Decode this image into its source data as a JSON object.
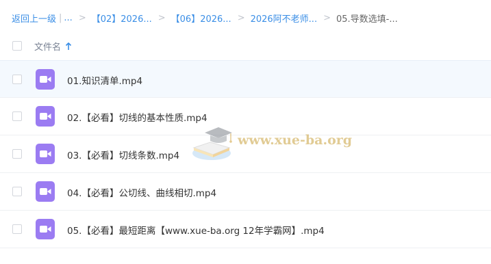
{
  "breadcrumb": {
    "back_label": "返回上一级",
    "separator": "|",
    "ellipsis": "...",
    "arrow": ">",
    "items": [
      {
        "label": "【02】2026..."
      },
      {
        "label": "【06】2026..."
      },
      {
        "label": "2026阿不老师..."
      }
    ],
    "current": "05.导数选填-..."
  },
  "table": {
    "column_name_label": "文件名",
    "sort_direction": "ascending",
    "rows": [
      {
        "name": "01.知识清单.mp4",
        "icon": "video-icon"
      },
      {
        "name": "02.【必看】切线的基本性质.mp4",
        "icon": "video-icon"
      },
      {
        "name": "03.【必看】切线条数.mp4",
        "icon": "video-icon"
      },
      {
        "name": "04.【必看】公切线、曲线相切.mp4",
        "icon": "video-icon"
      },
      {
        "name": "05.【必看】最短距离【www.xue-ba.org 12年学霸网】.mp4",
        "icon": "video-icon"
      }
    ]
  },
  "watermark": {
    "text": "www.xue-ba.org"
  },
  "colors": {
    "link": "#3a8ee6",
    "video_icon": "#9b7cf2",
    "selected_row": "#f4f9fe",
    "text": "#333333"
  }
}
